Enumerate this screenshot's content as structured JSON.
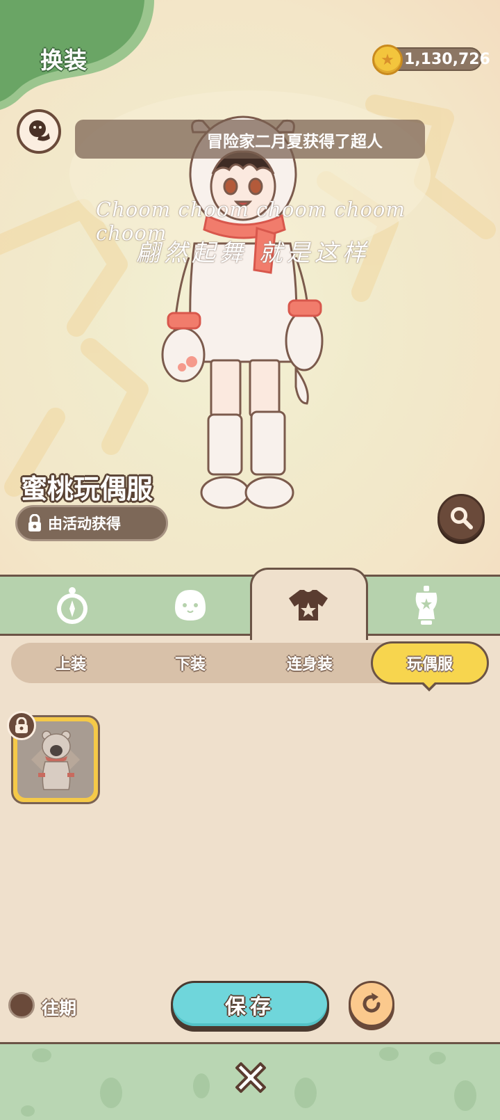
{
  "header": {
    "title": "换装",
    "coins": "1,130,726"
  },
  "ticker": {
    "message": "冒险家二月夏获得了超人"
  },
  "lyrics": {
    "line1": "Choom choom choom choom choom",
    "line2": "翩然起舞 就是这样"
  },
  "outfit": {
    "name": "蜜桃玩偶服",
    "obtain_hint": "由活动获得"
  },
  "category_tabs": [
    {
      "icon": "compass-icon",
      "active": false
    },
    {
      "icon": "face-icon",
      "active": false
    },
    {
      "icon": "shirt-icon",
      "active": true
    },
    {
      "icon": "mannequin-icon",
      "active": false
    }
  ],
  "sub_tabs": [
    {
      "label": "上装",
      "active": false
    },
    {
      "label": "下装",
      "active": false
    },
    {
      "label": "连身装",
      "active": false
    },
    {
      "label": "玩偶服",
      "active": true
    }
  ],
  "items": [
    {
      "name": "bear-costume-item",
      "locked": true,
      "selected": true
    }
  ],
  "controls": {
    "past_label": "往期",
    "save_label": "保存"
  },
  "colors": {
    "accent_yellow": "#f7d54e",
    "save_cyan": "#6fd6db",
    "tab_green": "#b6d2ad",
    "panel_beige": "#efe0cc",
    "outline_brown": "#6b5446"
  }
}
